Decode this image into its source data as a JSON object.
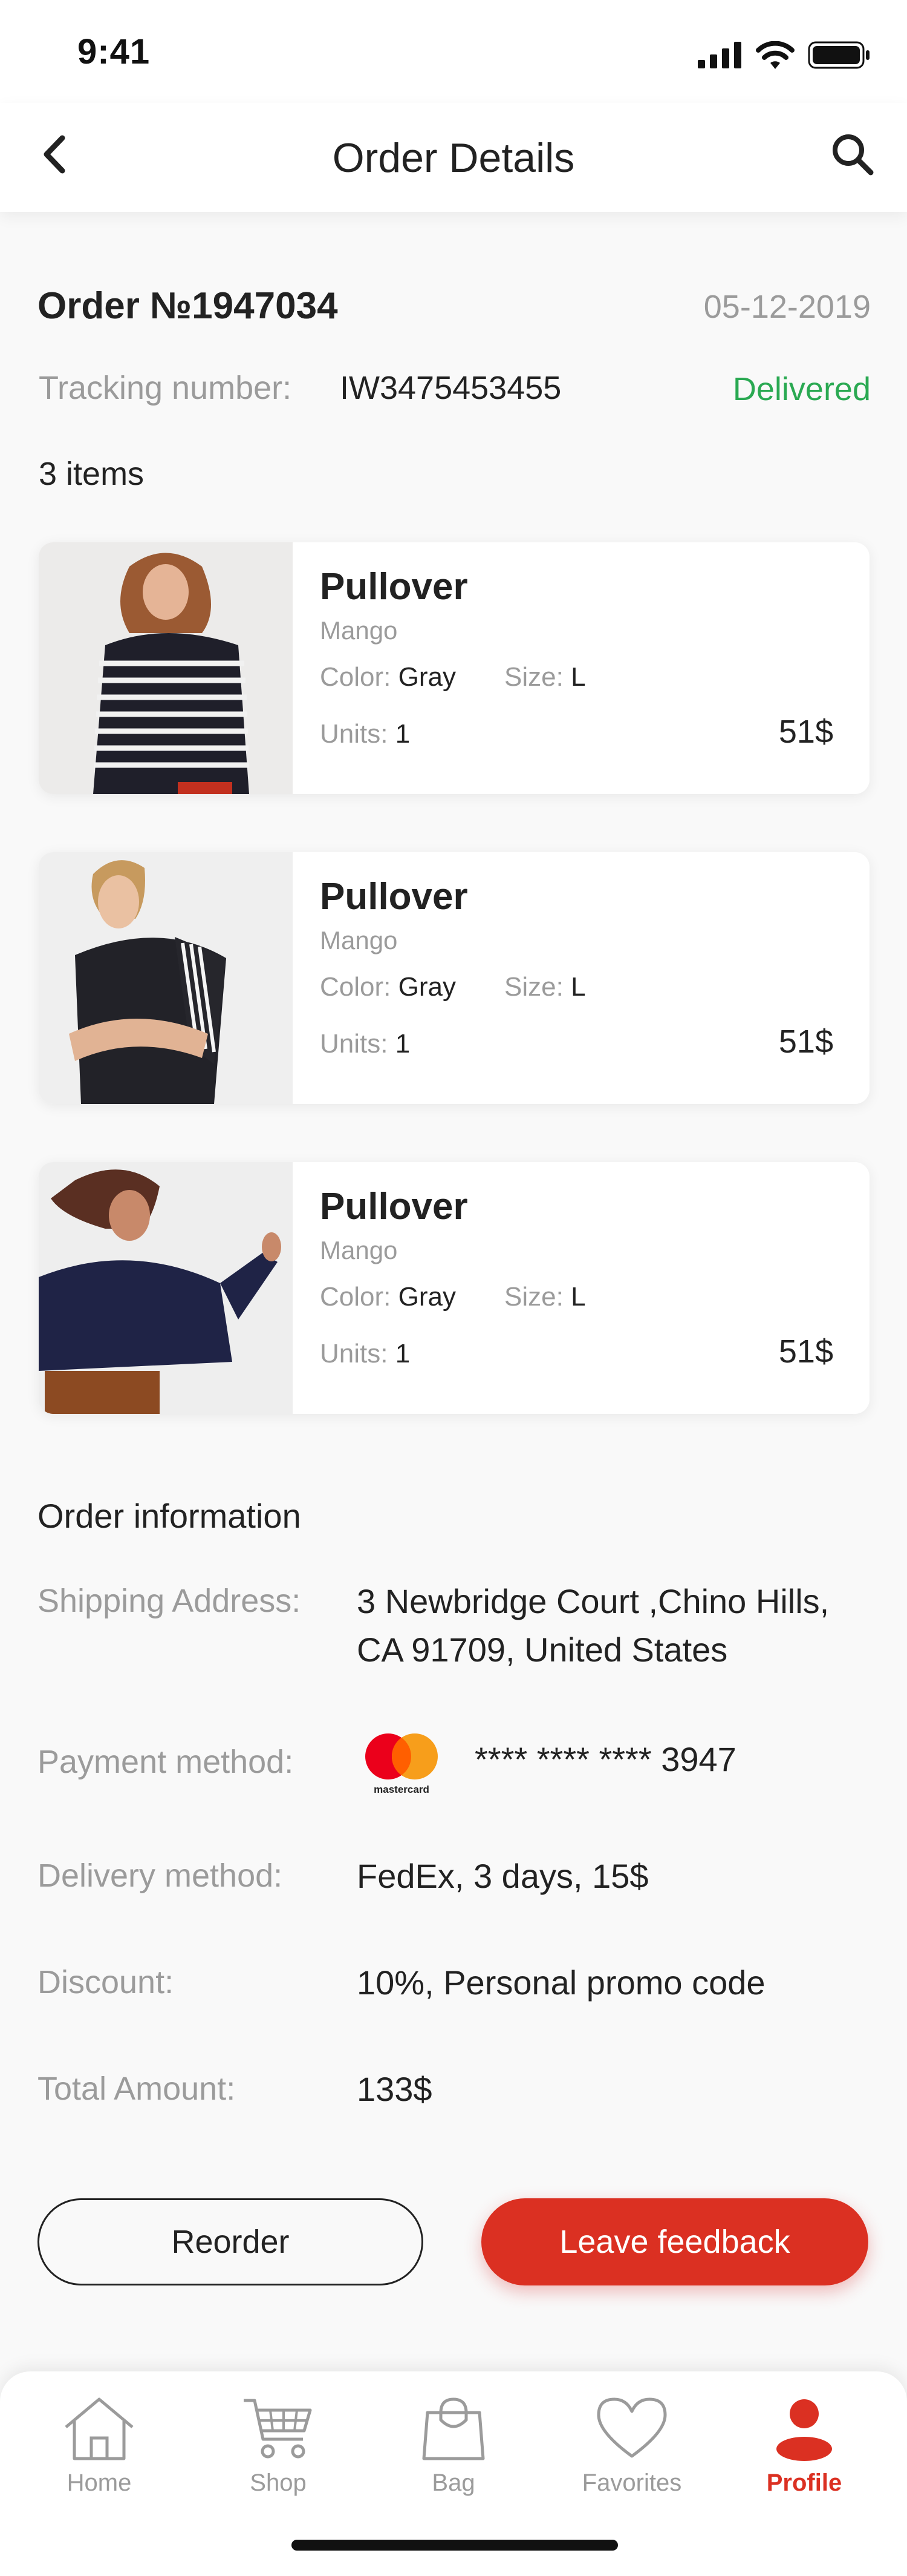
{
  "status_bar": {
    "time": "9:41"
  },
  "nav": {
    "title": "Order Details"
  },
  "order": {
    "number": "Order №1947034",
    "date": "05-12-2019",
    "tracking_label": "Tracking number:",
    "tracking_number": "IW3475453455",
    "status": "Delivered",
    "items_count": "3 items"
  },
  "labels": {
    "color": "Color:",
    "size": "Size:",
    "units": "Units:"
  },
  "items": [
    {
      "name": "Pullover",
      "brand": "Mango",
      "color": "Gray",
      "size": "L",
      "units": "1",
      "price": "51$"
    },
    {
      "name": "Pullover",
      "brand": "Mango",
      "color": "Gray",
      "size": "L",
      "units": "1",
      "price": "51$"
    },
    {
      "name": "Pullover",
      "brand": "Mango",
      "color": "Gray",
      "size": "L",
      "units": "1",
      "price": "51$"
    }
  ],
  "order_info": {
    "title": "Order information",
    "shipping_label": "Shipping Address:",
    "shipping_line1": "3 Newbridge Court ,Chino Hills,",
    "shipping_line2": "CA 91709, United States",
    "payment_label": "Payment method:",
    "card_number": "**** **** **** 3947",
    "card_brand": "mastercard",
    "delivery_label": "Delivery method:",
    "delivery_value": "FedEx, 3 days, 15$",
    "discount_label": "Discount:",
    "discount_value": "10%, Personal promo code",
    "total_label": "Total Amount:",
    "total_value": "133$"
  },
  "actions": {
    "reorder": "Reorder",
    "feedback": "Leave feedback"
  },
  "tabs": [
    {
      "label": "Home",
      "icon": "home-icon"
    },
    {
      "label": "Shop",
      "icon": "cart-icon"
    },
    {
      "label": "Bag",
      "icon": "bag-icon"
    },
    {
      "label": "Favorites",
      "icon": "heart-icon"
    },
    {
      "label": "Profile",
      "icon": "profile-icon",
      "active": true
    }
  ],
  "colors": {
    "accent": "#db3022",
    "success": "#2aa952",
    "muted": "#9b9b9b",
    "text": "#222222",
    "background": "#f9f9f9"
  }
}
